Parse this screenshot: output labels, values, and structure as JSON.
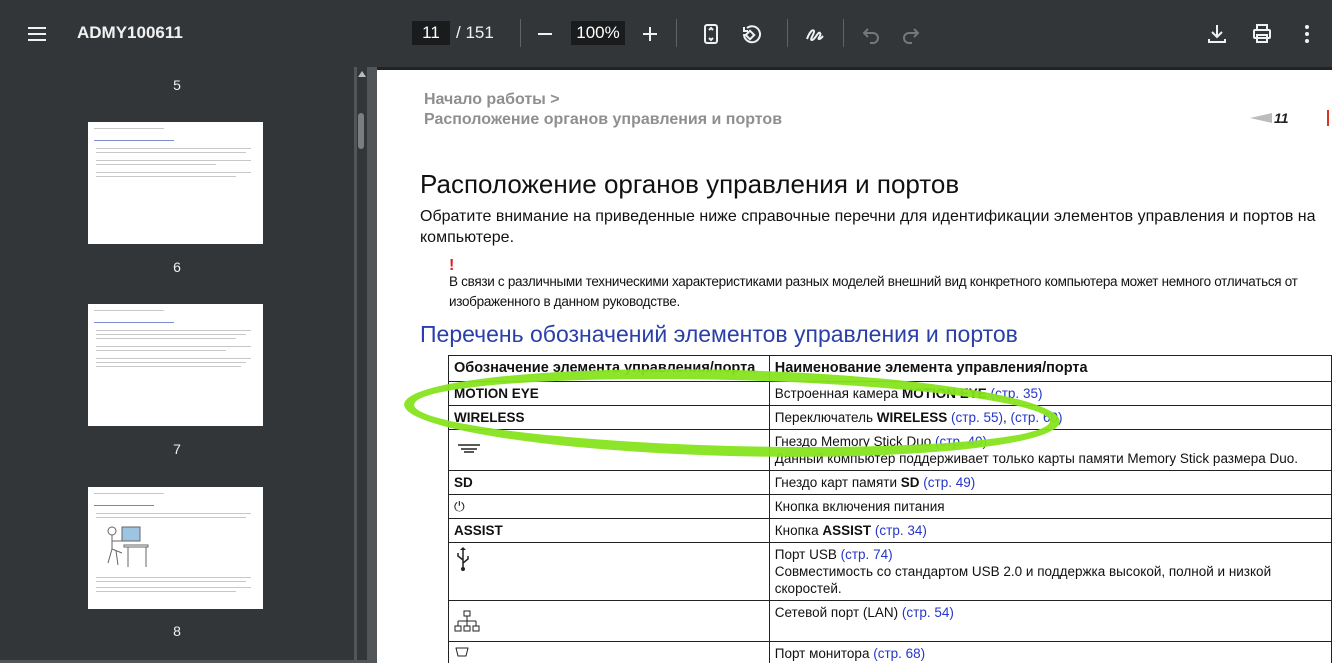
{
  "toolbar": {
    "menu_icon": "hamburger-menu-icon",
    "title": "ADMY100611",
    "page_current": "11",
    "page_total": "/ 151",
    "zoom": "100%"
  },
  "sidebar": {
    "thumbs": [
      {
        "num": "5"
      },
      {
        "num": "6"
      },
      {
        "num": "7"
      },
      {
        "num": "8"
      }
    ]
  },
  "page": {
    "breadcrumb_1": "Начало работы >",
    "breadcrumb_2": "Расположение органов управления и портов",
    "page_number": "11",
    "heading": "Расположение органов управления и портов",
    "intro": "Обратите внимание на приведенные ниже справочные перечни для идентификации элементов управления и портов на компьютере.",
    "warning_mark": "!",
    "warning_text": "В связи с различными техническими характеристиками разных моделей внешний вид конкретного компьютера может немного отличаться от изображенного в данном руководстве.",
    "subheading": "Перечень обозначений элементов управления и портов",
    "table": {
      "header_1": "Обозначение элемента управления/порта",
      "header_2": "Наименование элемента управления/порта",
      "r1_c1": "MOTION EYE",
      "r1_c2_a": "Встроенная камера ",
      "r1_c2_b": "MOTION EYE",
      "r1_c2_link": "(стр. 35)",
      "r2_c1": "WIRELESS",
      "r2_c2_a": "Переключатель ",
      "r2_c2_b": "WIRELESS",
      "r2_c2_link1": "(стр. 55)",
      "r2_c2_link2": "(стр. 60)",
      "r3_c2_a": "Гнездо Memory Stick Duo ",
      "r3_c2_link": "(стр. 40)",
      "r3_c2_note": "Данный компьютер поддерживает только карты памяти Memory Stick размера Duo.",
      "r4_c1": "SD",
      "r4_c2_a": "Гнездо карт памяти ",
      "r4_c2_b": "SD",
      "r4_c2_link": "(стр. 49)",
      "r5_c1": "⏻",
      "r5_c2": "Кнопка включения питания",
      "r6_c1": "ASSIST",
      "r6_c2_a": "Кнопка ",
      "r6_c2_b": "ASSIST",
      "r6_c2_link": "(стр. 34)",
      "r7_c2_a": "Порт USB ",
      "r7_c2_link": "(стр. 74)",
      "r7_c2_note": "Совместимость со стандартом USB 2.0 и поддержка высокой, полной и низкой скоростей.",
      "r8_c2_a": "Сетевой порт (LAN) ",
      "r8_c2_link": "(стр. 54)",
      "r9_c2_a": "Порт монитора ",
      "r9_c2_link": "(стр. 68)"
    }
  },
  "annotation": {
    "color": "#86e41c"
  }
}
